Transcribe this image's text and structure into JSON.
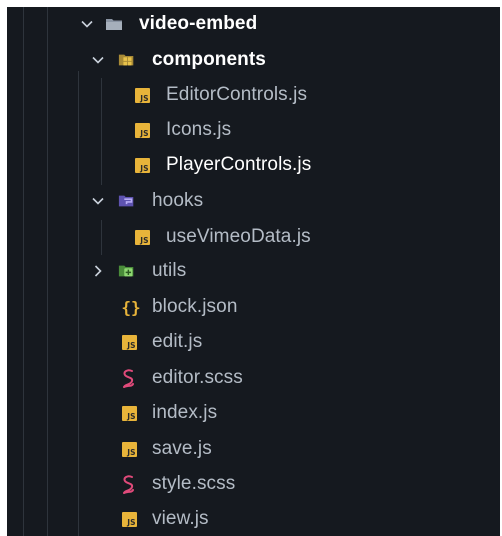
{
  "tree": {
    "items": [
      {
        "label": "video-embed",
        "kind": "folder",
        "icon": "folder-icon",
        "expanded": true,
        "depth": 0
      },
      {
        "label": "components",
        "kind": "folder",
        "icon": "components-folder-icon",
        "expanded": true,
        "depth": 1
      },
      {
        "label": "EditorControls.js",
        "kind": "file",
        "icon": "js-file-icon",
        "depth": 2
      },
      {
        "label": "Icons.js",
        "kind": "file",
        "icon": "js-file-icon",
        "depth": 2
      },
      {
        "label": "PlayerControls.js",
        "kind": "file",
        "icon": "js-file-icon",
        "depth": 2,
        "selected": true
      },
      {
        "label": "hooks",
        "kind": "folder",
        "icon": "hooks-folder-icon",
        "expanded": true,
        "depth": 1
      },
      {
        "label": "useVimeoData.js",
        "kind": "file",
        "icon": "js-file-icon",
        "depth": 2
      },
      {
        "label": "utils",
        "kind": "folder",
        "icon": "utils-folder-icon",
        "expanded": false,
        "depth": 1
      },
      {
        "label": "block.json",
        "kind": "file",
        "icon": "json-file-icon",
        "depth": 1
      },
      {
        "label": "edit.js",
        "kind": "file",
        "icon": "js-file-icon",
        "depth": 1
      },
      {
        "label": "editor.scss",
        "kind": "file",
        "icon": "scss-file-icon",
        "depth": 1
      },
      {
        "label": "index.js",
        "kind": "file",
        "icon": "js-file-icon",
        "depth": 1
      },
      {
        "label": "save.js",
        "kind": "file",
        "icon": "js-file-icon",
        "depth": 1
      },
      {
        "label": "style.scss",
        "kind": "file",
        "icon": "scss-file-icon",
        "depth": 1
      },
      {
        "label": "view.js",
        "kind": "file",
        "icon": "js-file-icon",
        "depth": 1
      }
    ]
  },
  "js_badge_text": "JS",
  "json_icon_glyph": "{}",
  "colors": {
    "background": "#15191f",
    "js": "#e8b43a",
    "json": "#e8b43a",
    "scss": "#e04a7a",
    "folder": "#8a94a3",
    "components_folder": "#e8b43a",
    "hooks_folder": "#7c6fd6",
    "utils_folder": "#5fae4a"
  }
}
